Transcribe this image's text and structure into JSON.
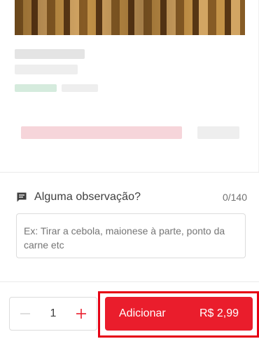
{
  "observation": {
    "title": "Alguma observação?",
    "counter": "0/140",
    "placeholder": "Ex: Tirar a cebola, maionese à parte, ponto da carne etc",
    "icon": "comment-icon"
  },
  "quantity": {
    "value": "1",
    "decrement_icon": "minus-icon",
    "increment_icon": "plus-icon"
  },
  "add_button": {
    "label": "Adicionar",
    "price": "R$ 2,99"
  },
  "colors": {
    "brand_red": "#ea1d2c",
    "highlight_red": "#e60014",
    "text_dark": "#3e3e3e",
    "placeholder_gray": "#a6a6a6"
  }
}
